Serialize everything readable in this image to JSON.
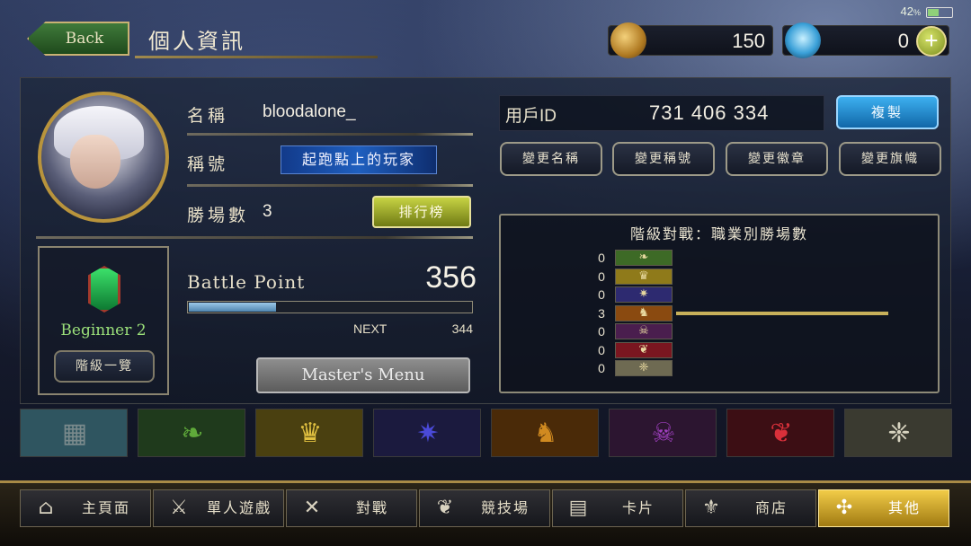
{
  "header": {
    "back_label": "Back",
    "page_title": "個人資訊"
  },
  "status": {
    "battery_percent": "42",
    "battery_unit": "%"
  },
  "currency": {
    "rupees": "150",
    "crystals": "0",
    "add_label": "+"
  },
  "profile": {
    "name_label": "名稱",
    "name_value": "bloodalone_",
    "title_label": "稱號",
    "title_value": "起跑點上的玩家",
    "wins_label": "勝場數",
    "wins_value": "3",
    "ranking_button": "排行榜",
    "uid_label": "用戶ID",
    "uid_value": "731 406 334",
    "copy_button": "複製"
  },
  "change_buttons": {
    "name": "變更名稱",
    "title": "變更稱號",
    "emblem": "變更徽章",
    "flag": "變更旗幟"
  },
  "rank": {
    "name": "Beginner 2",
    "list_button": "階級一覽"
  },
  "battle_point": {
    "label": "Battle Point",
    "value": "356",
    "next_label": "NEXT",
    "next_value": "344",
    "progress_fraction": 0.31
  },
  "master_menu_button": "Master's Menu",
  "class_wins": {
    "title": "階級對戰：職業別勝場數",
    "max_bar": 3,
    "rows": [
      {
        "class": "forestcraft",
        "count": "0",
        "color": "#3d6a26",
        "icon": "leaf-icon"
      },
      {
        "class": "swordcraft",
        "count": "0",
        "color": "#8f7a1a",
        "icon": "crown-icon"
      },
      {
        "class": "runecraft",
        "count": "0",
        "color": "#2d2a70",
        "icon": "rune-star-icon"
      },
      {
        "class": "dragoncraft",
        "count": "3",
        "color": "#8a4a10",
        "icon": "dragon-icon"
      },
      {
        "class": "shadowcraft",
        "count": "0",
        "color": "#4a1e4e",
        "icon": "skull-icon"
      },
      {
        "class": "bloodcraft",
        "count": "0",
        "color": "#7a1620",
        "icon": "bat-wing-icon"
      },
      {
        "class": "havencraft",
        "count": "0",
        "color": "#6e6a52",
        "icon": "wing-icon"
      }
    ]
  },
  "class_tabs": [
    {
      "name": "neutral",
      "icon": "card-icon",
      "color": "#2f5560"
    },
    {
      "name": "forest",
      "icon": "leaf-icon",
      "color": "#1f3a1c"
    },
    {
      "name": "sword",
      "icon": "crown-icon",
      "color": "#4a4010"
    },
    {
      "name": "rune",
      "icon": "rune-star-icon",
      "color": "#1b1a3e"
    },
    {
      "name": "dragon",
      "icon": "dragon-icon",
      "color": "#4a2a08"
    },
    {
      "name": "shadow",
      "icon": "skull-icon",
      "color": "#2c1530"
    },
    {
      "name": "blood",
      "icon": "bat-wing-icon",
      "color": "#3c0e14"
    },
    {
      "name": "haven",
      "icon": "wing-icon",
      "color": "#3a3a30"
    }
  ],
  "nav": {
    "home": "主頁面",
    "solo": "單人遊戲",
    "battle": "對戰",
    "arena": "競技場",
    "cards": "卡片",
    "shop": "商店",
    "other": "其他"
  }
}
